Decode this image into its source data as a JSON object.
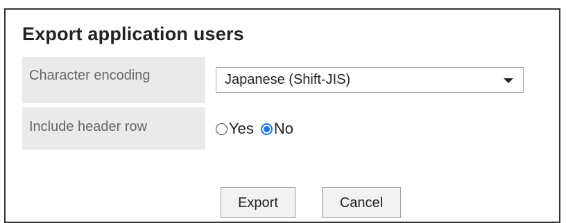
{
  "dialog": {
    "title": "Export application users"
  },
  "fields": {
    "encoding": {
      "label": "Character encoding",
      "selected": "Japanese (Shift-JIS)"
    },
    "header_row": {
      "label": "Include header row",
      "options": [
        {
          "label": "Yes",
          "selected": false
        },
        {
          "label": "No",
          "selected": true
        }
      ]
    }
  },
  "actions": {
    "export_label": "Export",
    "cancel_label": "Cancel"
  },
  "colors": {
    "accent": "#1a73e8",
    "label_bg": "#eaeaea"
  },
  "icons": {
    "select_caret": "chevron-down-icon"
  }
}
